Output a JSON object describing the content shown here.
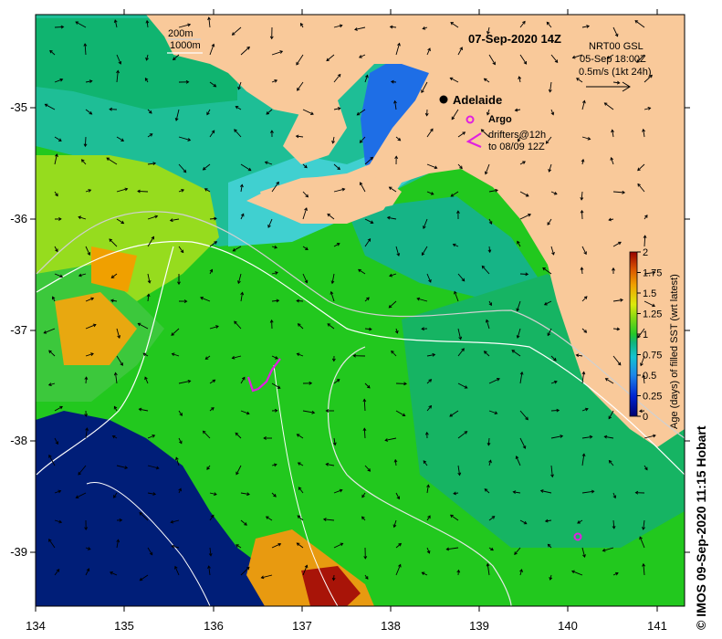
{
  "map": {
    "date_title": "07-Sep-2020 14Z",
    "contour_legend": {
      "line1": "200m",
      "line2": "1000m"
    },
    "current_legend": {
      "line1": "NRT00 GSL",
      "line2": "05-Sep 18:00Z",
      "line3": "0.5m/s (1kt 24h)"
    },
    "city_label": "Adelaide",
    "argo_label": "Argo",
    "drifter_label": {
      "line1": "drifters@12h",
      "line2": "to 08/09 12Z"
    },
    "credit": "© IMOS 09-Sep-2020 11:15 Hobart",
    "colors": {
      "land": "#f9c99a",
      "ocean_old": "#001e78",
      "sst_green": "#22c81e",
      "argo": "#e020e0"
    }
  },
  "axes": {
    "x_ticks": [
      "134",
      "135",
      "136",
      "137",
      "138",
      "139",
      "140",
      "141"
    ],
    "y_ticks": [
      "-35",
      "-36",
      "-37",
      "-38",
      "-39"
    ]
  },
  "colorbar": {
    "label": "Age (days) of filled SST (wrt latest)",
    "min": 0,
    "max": 2,
    "ticks": [
      "0",
      "0.25",
      "0.5",
      "0.75",
      "1",
      "1.25",
      "1.5",
      "1.75",
      "2"
    ]
  },
  "chart_data": {
    "type": "heatmap",
    "title": "07-Sep-2020 14Z",
    "x_ticks": [
      134,
      135,
      136,
      137,
      138,
      139,
      140,
      141
    ],
    "y_ticks": [
      -35,
      -36,
      -37,
      -38,
      -39
    ],
    "xlim": [
      134,
      141.3
    ],
    "ylim": [
      -39.5,
      -34.2
    ],
    "colorbar_range": [
      0,
      2
    ],
    "markers": [
      {
        "label": "Adelaide",
        "lon": 138.6,
        "lat": -34.93
      },
      {
        "label": "Argo",
        "lon": 140.1,
        "lat": -38.85
      }
    ]
  }
}
